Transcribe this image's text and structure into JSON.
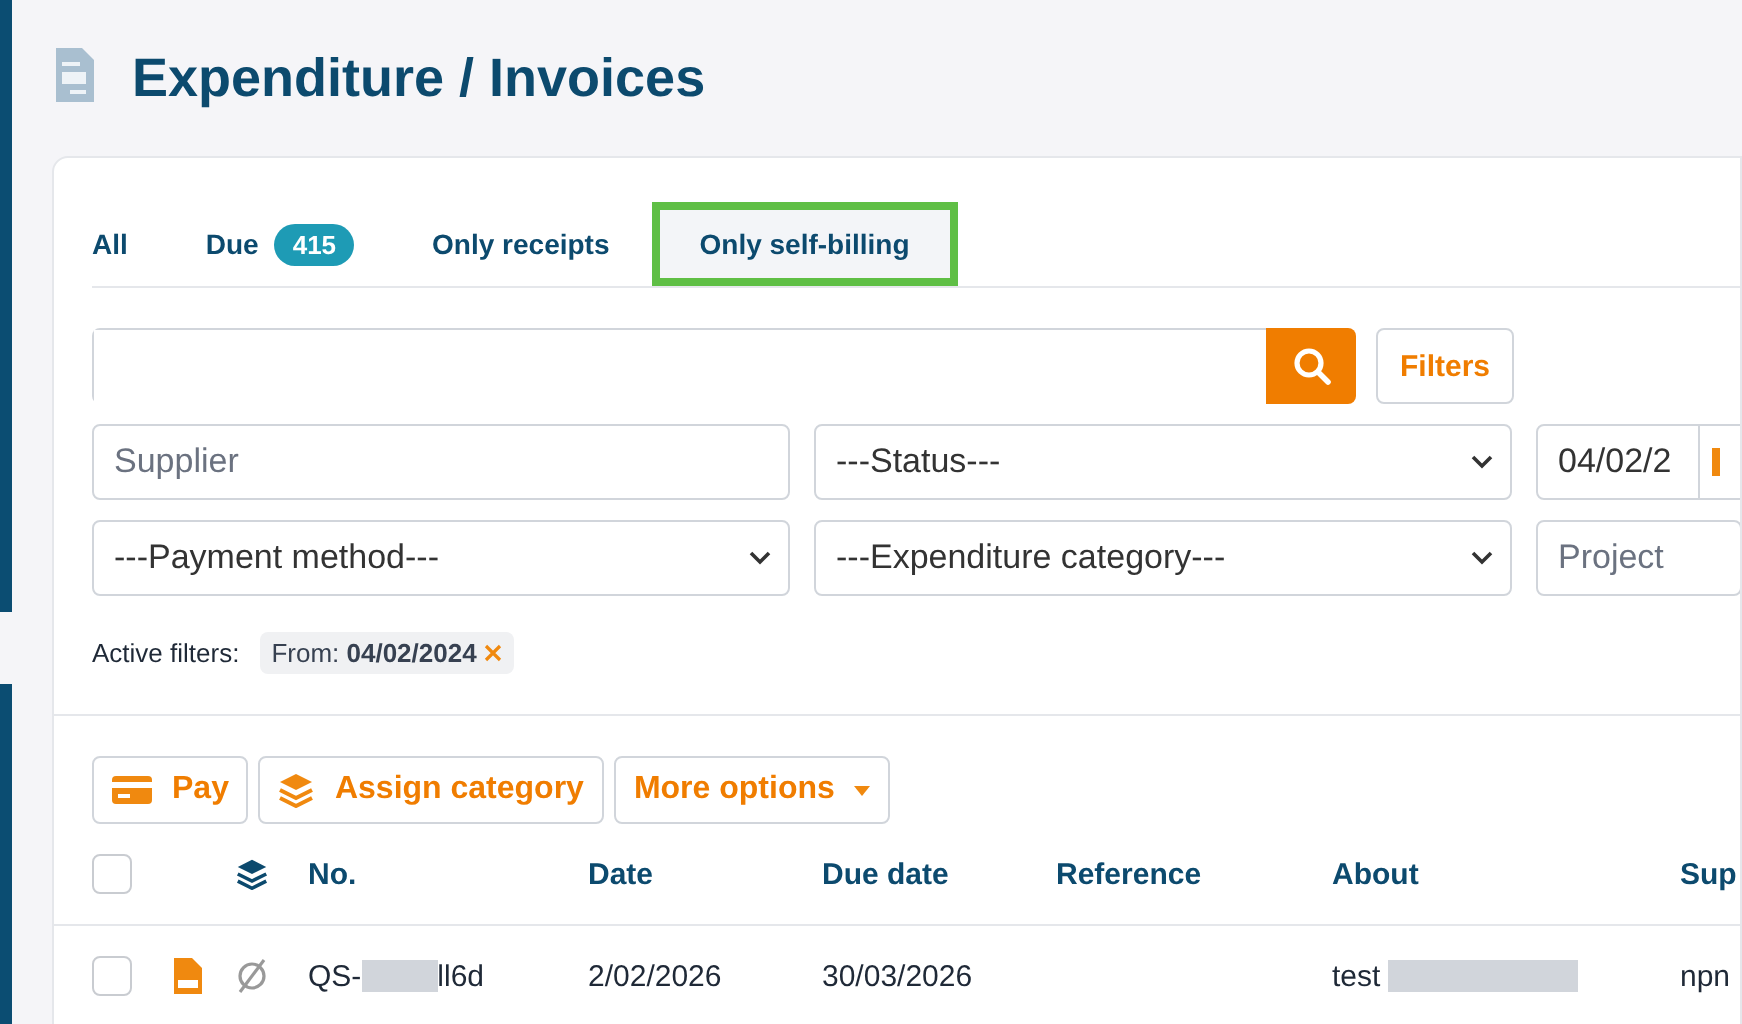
{
  "page_title": "Expenditure / Invoices",
  "tabs": [
    {
      "label": "All",
      "selected": false
    },
    {
      "label": "Due",
      "badge": "415",
      "selected": false
    },
    {
      "label": "Only receipts",
      "selected": false
    },
    {
      "label": "Only self-billing",
      "selected": true
    }
  ],
  "search": {
    "button": "Filters"
  },
  "filters": [
    {
      "kind": "input",
      "placeholder": "Supplier"
    },
    {
      "kind": "select",
      "value": "---Status---"
    },
    {
      "kind": "date",
      "value": "04/02/2"
    },
    {
      "kind": "select",
      "value": "---Payment method---"
    },
    {
      "kind": "select",
      "value": "---Expenditure category---"
    },
    {
      "kind": "input",
      "placeholder": "Project"
    }
  ],
  "active_filters": {
    "label": "Active filters:",
    "chips": [
      {
        "key": "From:",
        "value": "04/02/2024"
      }
    ]
  },
  "actions": [
    {
      "kind": "pay",
      "label": "Pay"
    },
    {
      "kind": "category",
      "label": "Assign category"
    },
    {
      "kind": "dropdown",
      "label": "More options"
    }
  ],
  "table": {
    "select_all_checked": false,
    "columns": [
      "No.",
      "Date",
      "Due date",
      "Reference",
      "About",
      "Sup"
    ],
    "rows": [
      {
        "checked": false,
        "no_start": "QS-",
        "no_end": "ll6d",
        "date": "2/02/2026",
        "due_date": "30/03/2026",
        "about": "test",
        "supplier": "npn"
      }
    ]
  }
}
